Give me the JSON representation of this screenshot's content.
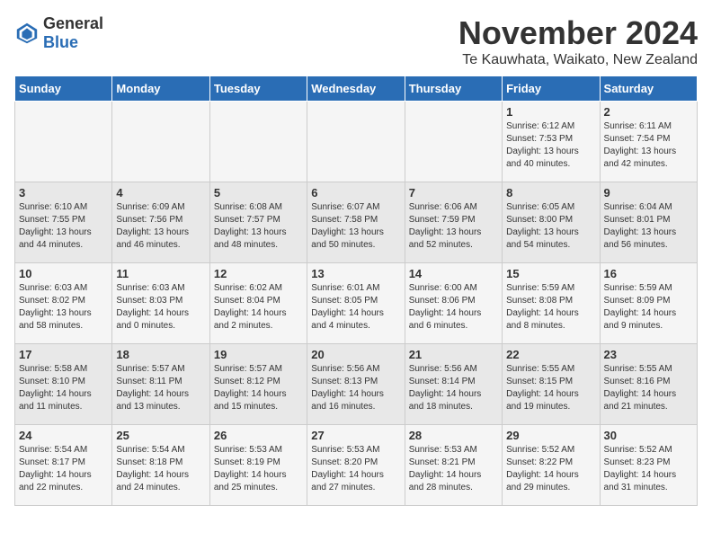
{
  "logo": {
    "general": "General",
    "blue": "Blue"
  },
  "header": {
    "month": "November 2024",
    "location": "Te Kauwhata, Waikato, New Zealand"
  },
  "weekdays": [
    "Sunday",
    "Monday",
    "Tuesday",
    "Wednesday",
    "Thursday",
    "Friday",
    "Saturday"
  ],
  "weeks": [
    [
      {
        "day": "",
        "info": ""
      },
      {
        "day": "",
        "info": ""
      },
      {
        "day": "",
        "info": ""
      },
      {
        "day": "",
        "info": ""
      },
      {
        "day": "",
        "info": ""
      },
      {
        "day": "1",
        "info": "Sunrise: 6:12 AM\nSunset: 7:53 PM\nDaylight: 13 hours\nand 40 minutes."
      },
      {
        "day": "2",
        "info": "Sunrise: 6:11 AM\nSunset: 7:54 PM\nDaylight: 13 hours\nand 42 minutes."
      }
    ],
    [
      {
        "day": "3",
        "info": "Sunrise: 6:10 AM\nSunset: 7:55 PM\nDaylight: 13 hours\nand 44 minutes."
      },
      {
        "day": "4",
        "info": "Sunrise: 6:09 AM\nSunset: 7:56 PM\nDaylight: 13 hours\nand 46 minutes."
      },
      {
        "day": "5",
        "info": "Sunrise: 6:08 AM\nSunset: 7:57 PM\nDaylight: 13 hours\nand 48 minutes."
      },
      {
        "day": "6",
        "info": "Sunrise: 6:07 AM\nSunset: 7:58 PM\nDaylight: 13 hours\nand 50 minutes."
      },
      {
        "day": "7",
        "info": "Sunrise: 6:06 AM\nSunset: 7:59 PM\nDaylight: 13 hours\nand 52 minutes."
      },
      {
        "day": "8",
        "info": "Sunrise: 6:05 AM\nSunset: 8:00 PM\nDaylight: 13 hours\nand 54 minutes."
      },
      {
        "day": "9",
        "info": "Sunrise: 6:04 AM\nSunset: 8:01 PM\nDaylight: 13 hours\nand 56 minutes."
      }
    ],
    [
      {
        "day": "10",
        "info": "Sunrise: 6:03 AM\nSunset: 8:02 PM\nDaylight: 13 hours\nand 58 minutes."
      },
      {
        "day": "11",
        "info": "Sunrise: 6:03 AM\nSunset: 8:03 PM\nDaylight: 14 hours\nand 0 minutes."
      },
      {
        "day": "12",
        "info": "Sunrise: 6:02 AM\nSunset: 8:04 PM\nDaylight: 14 hours\nand 2 minutes."
      },
      {
        "day": "13",
        "info": "Sunrise: 6:01 AM\nSunset: 8:05 PM\nDaylight: 14 hours\nand 4 minutes."
      },
      {
        "day": "14",
        "info": "Sunrise: 6:00 AM\nSunset: 8:06 PM\nDaylight: 14 hours\nand 6 minutes."
      },
      {
        "day": "15",
        "info": "Sunrise: 5:59 AM\nSunset: 8:08 PM\nDaylight: 14 hours\nand 8 minutes."
      },
      {
        "day": "16",
        "info": "Sunrise: 5:59 AM\nSunset: 8:09 PM\nDaylight: 14 hours\nand 9 minutes."
      }
    ],
    [
      {
        "day": "17",
        "info": "Sunrise: 5:58 AM\nSunset: 8:10 PM\nDaylight: 14 hours\nand 11 minutes."
      },
      {
        "day": "18",
        "info": "Sunrise: 5:57 AM\nSunset: 8:11 PM\nDaylight: 14 hours\nand 13 minutes."
      },
      {
        "day": "19",
        "info": "Sunrise: 5:57 AM\nSunset: 8:12 PM\nDaylight: 14 hours\nand 15 minutes."
      },
      {
        "day": "20",
        "info": "Sunrise: 5:56 AM\nSunset: 8:13 PM\nDaylight: 14 hours\nand 16 minutes."
      },
      {
        "day": "21",
        "info": "Sunrise: 5:56 AM\nSunset: 8:14 PM\nDaylight: 14 hours\nand 18 minutes."
      },
      {
        "day": "22",
        "info": "Sunrise: 5:55 AM\nSunset: 8:15 PM\nDaylight: 14 hours\nand 19 minutes."
      },
      {
        "day": "23",
        "info": "Sunrise: 5:55 AM\nSunset: 8:16 PM\nDaylight: 14 hours\nand 21 minutes."
      }
    ],
    [
      {
        "day": "24",
        "info": "Sunrise: 5:54 AM\nSunset: 8:17 PM\nDaylight: 14 hours\nand 22 minutes."
      },
      {
        "day": "25",
        "info": "Sunrise: 5:54 AM\nSunset: 8:18 PM\nDaylight: 14 hours\nand 24 minutes."
      },
      {
        "day": "26",
        "info": "Sunrise: 5:53 AM\nSunset: 8:19 PM\nDaylight: 14 hours\nand 25 minutes."
      },
      {
        "day": "27",
        "info": "Sunrise: 5:53 AM\nSunset: 8:20 PM\nDaylight: 14 hours\nand 27 minutes."
      },
      {
        "day": "28",
        "info": "Sunrise: 5:53 AM\nSunset: 8:21 PM\nDaylight: 14 hours\nand 28 minutes."
      },
      {
        "day": "29",
        "info": "Sunrise: 5:52 AM\nSunset: 8:22 PM\nDaylight: 14 hours\nand 29 minutes."
      },
      {
        "day": "30",
        "info": "Sunrise: 5:52 AM\nSunset: 8:23 PM\nDaylight: 14 hours\nand 31 minutes."
      }
    ]
  ]
}
